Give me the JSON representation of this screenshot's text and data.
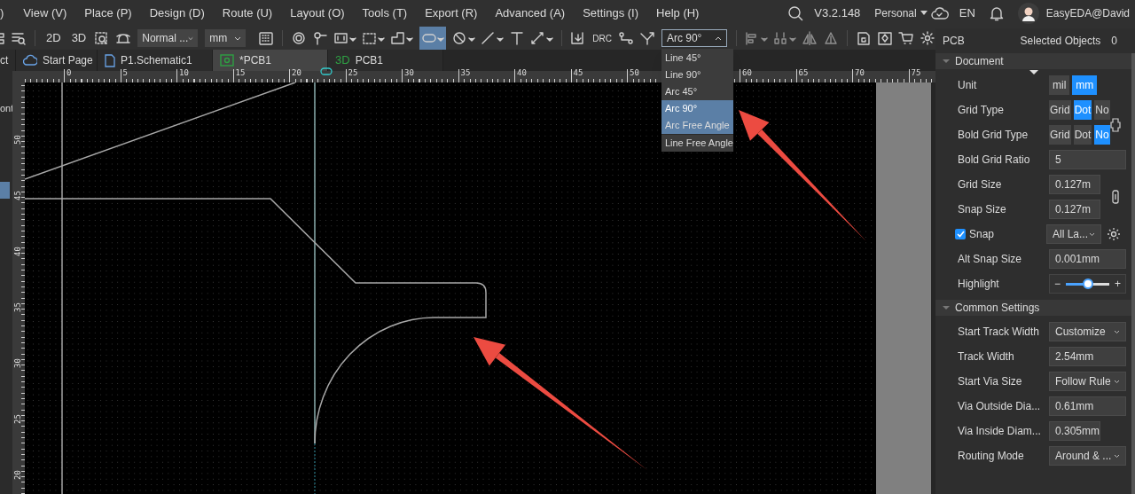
{
  "menu": {
    "items": [
      ")",
      "View (V)",
      "Place (P)",
      "Design (D)",
      "Route (U)",
      "Layout (O)",
      "Tools (T)",
      "Export (R)",
      "Advanced (A)",
      "Settings (I)",
      "Help (H)"
    ],
    "version": "V3.2.148",
    "plan": "Personal",
    "language": "EN",
    "user": "EasyEDA@David"
  },
  "toolbar": {
    "view_2d": "2D",
    "view_3d": "3D",
    "layer_select": "Normal ...",
    "unit_select": "mm",
    "shape_tool": {
      "selected": true
    },
    "drc": "DRC",
    "routing_angle": {
      "value": "Arc 90°",
      "expanded": true,
      "options": [
        {
          "label": "Line 45°",
          "selected": false,
          "highlighted": false
        },
        {
          "label": "Line 90°",
          "selected": false,
          "highlighted": false
        },
        {
          "label": "Arc 45°",
          "selected": false,
          "highlighted": false
        },
        {
          "label": "Arc 90°",
          "selected": true,
          "highlighted": true
        },
        {
          "label": "Arc Free Angle",
          "selected": false,
          "highlighted": true
        },
        {
          "label": "Line Free Angle",
          "selected": false,
          "highlighted": false
        }
      ]
    }
  },
  "tabs": [
    {
      "kind": "cut",
      "label": "ct",
      "selected": false
    },
    {
      "kind": "cloud",
      "label": "Start Page",
      "selected": false
    },
    {
      "kind": "schematic",
      "label": "P1.Schematic1",
      "selected": false
    },
    {
      "kind": "pcb",
      "label": "*PCB1",
      "selected": true
    },
    {
      "kind": "viewer",
      "badge": "3D",
      "label": "PCB1",
      "selected": false
    }
  ],
  "left_panel": {
    "text": "ont"
  },
  "ruler": {
    "top_labels": [
      "0",
      "5",
      "10",
      "15",
      "20",
      "25",
      "30",
      "35",
      "40",
      "45",
      "50",
      "60",
      "65",
      "70",
      "75"
    ],
    "left_labels": [
      "50",
      "45",
      "40",
      "35",
      "30",
      "25",
      "20"
    ]
  },
  "properties": {
    "title": "PCB",
    "selected_label": "Selected Objects",
    "selected_count": "0",
    "sections": [
      {
        "title": "Document",
        "expanded": true,
        "rows": [
          {
            "kind": "toggle",
            "label": "Unit",
            "options": [
              {
                "label": "mil",
                "selected": false
              },
              {
                "label": "mm",
                "selected": true
              }
            ]
          },
          {
            "kind": "toggle",
            "label": "Grid Type",
            "options": [
              {
                "label": "Grid",
                "selected": false
              },
              {
                "label": "Dot",
                "selected": true
              },
              {
                "label": "No",
                "selected": false
              }
            ]
          },
          {
            "kind": "toggle",
            "label": "Bold Grid Type",
            "options": [
              {
                "label": "Grid",
                "selected": false
              },
              {
                "label": "Dot",
                "selected": false
              },
              {
                "label": "No",
                "selected": true
              }
            ]
          },
          {
            "kind": "input",
            "label": "Bold Grid Ratio",
            "value": "5"
          },
          {
            "kind": "input",
            "label": "Grid Size",
            "value": "0.127m"
          },
          {
            "kind": "input",
            "label": "Snap Size",
            "value": "0.127m"
          },
          {
            "kind": "checkbox-select",
            "label": "Snap",
            "checked": true,
            "value": "All La..."
          },
          {
            "kind": "input",
            "label": "Alt Snap Size",
            "value": "0.001mm"
          },
          {
            "kind": "slider",
            "label": "Highlight",
            "minus": "−",
            "plus": "+",
            "level": 0.5
          }
        ]
      },
      {
        "title": "Common Settings",
        "expanded": true,
        "rows": [
          {
            "kind": "select",
            "label": "Start Track Width",
            "value": "Customize"
          },
          {
            "kind": "input",
            "label": "Track Width",
            "value": "2.54mm"
          },
          {
            "kind": "select",
            "label": "Start Via Size",
            "value": "Follow Rule"
          },
          {
            "kind": "input",
            "label": "Via Outside Dia...",
            "value": "0.61mm"
          },
          {
            "kind": "input",
            "label": "Via Inside Diam...",
            "value": "0.305mm"
          },
          {
            "kind": "select",
            "label": "Routing Mode",
            "value": "Around & ..."
          }
        ]
      }
    ]
  }
}
